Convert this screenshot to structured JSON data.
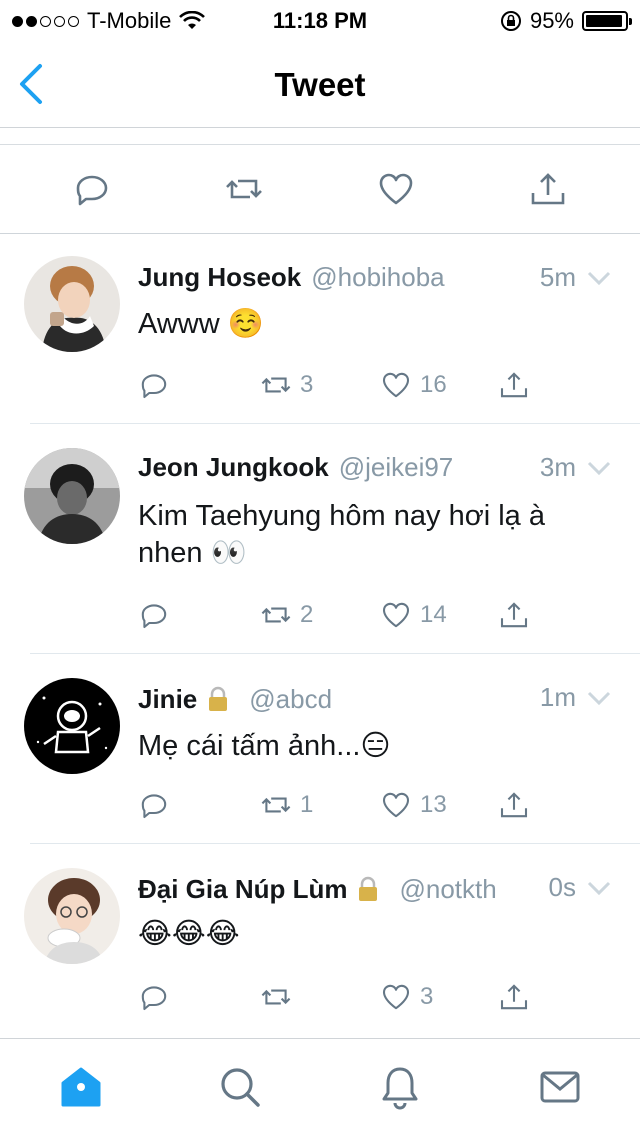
{
  "status_bar": {
    "carrier": "T-Mobile",
    "time": "11:18 PM",
    "battery": "95%",
    "battery_level": 0.95
  },
  "nav": {
    "title": "Tweet",
    "back_icon": "chevron-left-icon"
  },
  "main_actions": [
    "reply-icon",
    "retweet-icon",
    "like-icon",
    "share-icon"
  ],
  "replies": [
    {
      "name": "Jung Hoseok",
      "handle": "@hobihoba",
      "time": "5m",
      "locked": false,
      "text": "Awww ☺️",
      "retweets": "3",
      "likes": "16"
    },
    {
      "name": "Jeon Jungkook",
      "handle": "@jeikei97",
      "time": "3m",
      "locked": false,
      "text": "Kim Taehyung hôm nay hơi lạ à nhen 👀",
      "retweets": "2",
      "likes": "14"
    },
    {
      "name": "Jinie",
      "handle": "@abcd",
      "time": "1m",
      "locked": true,
      "text": "Mẹ cái tấm ảnh...😑",
      "retweets": "1",
      "likes": "13"
    },
    {
      "name": "Đại Gia Núp Lùm",
      "handle": "@notkth",
      "time": "0s",
      "locked": true,
      "text": "😂😂😂",
      "retweets": "",
      "likes": "3"
    }
  ],
  "tabs": [
    "home-icon",
    "search-icon",
    "notifications-icon",
    "messages-icon"
  ],
  "colors": {
    "accent": "#1da1f2",
    "icon_gray": "#657786",
    "meta_gray": "#8899a6"
  }
}
